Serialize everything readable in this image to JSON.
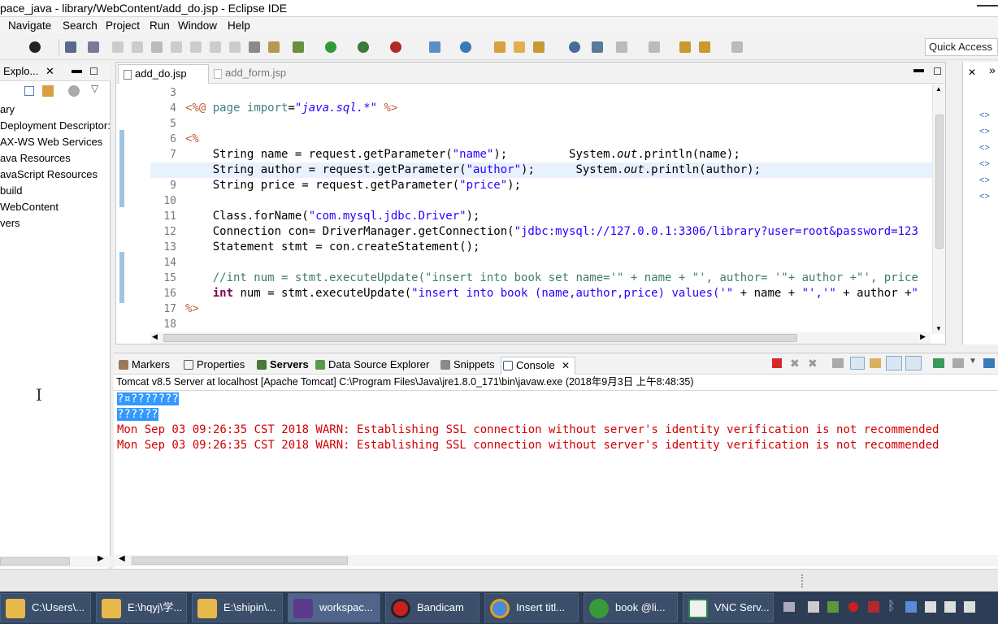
{
  "window": {
    "title": "pace_java - library/WebContent/add_do.jsp - Eclipse IDE"
  },
  "menu": {
    "items": [
      "Navigate",
      "Search",
      "Project",
      "Run",
      "Window",
      "Help"
    ]
  },
  "toolbar": {
    "quick_access": "Quick Access"
  },
  "left_panel": {
    "title": "Explo...",
    "tree": [
      "ary",
      "Deployment Descriptor:",
      "AX-WS Web Services",
      "ava Resources",
      "avaScript Resources",
      "build",
      "WebContent",
      "vers"
    ]
  },
  "editor": {
    "tabs": [
      {
        "label": "add_do.jsp",
        "active": true
      },
      {
        "label": "add_form.jsp",
        "active": false
      }
    ],
    "line_numbers": [
      "3",
      "4",
      "5",
      "6",
      "7",
      "8",
      "9",
      "10",
      "11",
      "12",
      "13",
      "14",
      "15",
      "16",
      "17",
      "18"
    ]
  },
  "bottom_panel": {
    "tabs": [
      "Markers",
      "Properties",
      "Servers",
      "Data Source Explorer",
      "Snippets",
      "Console"
    ],
    "active_tab": "Console",
    "console_title": "Tomcat v8.5 Server at localhost [Apache Tomcat] C:\\Program Files\\Java\\jre1.8.0_171\\bin\\javaw.exe (2018年9月3日 上午8:48:35)",
    "lines": [
      {
        "text": "?¤???????",
        "style": "selected"
      },
      {
        "text": "??????",
        "style": "selected"
      },
      {
        "text": "Mon Sep 03 09:26:35 CST 2018 WARN: Establishing SSL connection without server's identity verification is not recommended",
        "style": "warn"
      },
      {
        "text": "Mon Sep 03 09:26:35 CST 2018 WARN: Establishing SSL connection without server's identity verification is not recommended",
        "style": "warn"
      }
    ]
  },
  "taskbar": {
    "items": [
      "C:\\Users\\...",
      "E:\\hqyj\\学...",
      "E:\\shipin\\...",
      "workspac...",
      "Bandicam",
      "Insert titl...",
      "book @li...",
      "VNC Serv..."
    ]
  },
  "colors": {
    "keyword": "#7f0055",
    "string": "#2a00ff",
    "comment": "#3f7f5f",
    "warn": "#d40000",
    "selection": "#3399ff"
  }
}
